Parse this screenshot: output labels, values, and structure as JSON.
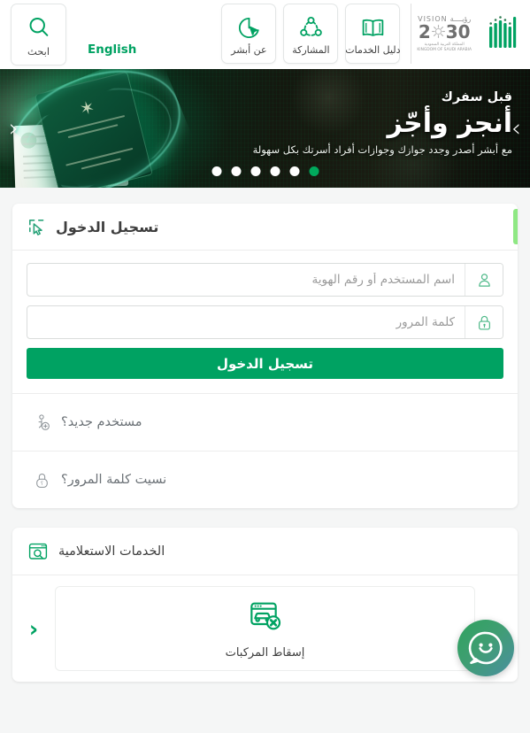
{
  "header": {
    "search_tile": {
      "label": "ابحث",
      "icon": "search-icon"
    },
    "language_link": "English",
    "nav_tiles": [
      {
        "label": "عن أبشر",
        "icon": "cursor-circle-icon"
      },
      {
        "label": "المشاركة",
        "icon": "share-network-icon"
      },
      {
        "label": "دليل الخدمات",
        "icon": "book-icon"
      }
    ],
    "vision_logo": {
      "word": "VISION",
      "arabic_word": "رؤيــــة",
      "year": "2030",
      "kingdom_ar": "المملكة العربية السعودية",
      "kingdom_en": "KINGDOM OF SAUDI ARABIA"
    },
    "absher_logo": "absher-logo"
  },
  "banner": {
    "kicker": "قبل سفرك",
    "title": "أنجز وأجّز",
    "subtitle": "مع أبشر أصدر وجدد جوازك وجوازات أفراد أسرتك بكل سهولة",
    "prev_arrow": "‹",
    "next_arrow": "›",
    "dots_count": 6,
    "active_dot_index": 5
  },
  "login_card": {
    "title": "تسجيل الدخول",
    "title_icon": "select-cursor-icon",
    "accent_color": "#8fe884",
    "username_field": {
      "placeholder": "اسم المستخدم أو رقم الهوية",
      "value": "",
      "icon": "user-icon"
    },
    "password_field": {
      "placeholder": "كلمة المرور",
      "value": "",
      "icon": "lock-icon"
    },
    "submit_label": "تسجيل الدخول",
    "submit_color": "#00a262",
    "links": [
      {
        "label": "مستخدم جديد؟",
        "icon": "user-add-icon"
      },
      {
        "label": "نسيت كلمة المرور؟",
        "icon": "lock-question-icon"
      }
    ]
  },
  "services_card": {
    "title": "الخدمات الاستعلامية",
    "title_icon": "window-search-icon",
    "prev_arrow": "‹",
    "next_arrow": "›",
    "items": [
      {
        "label": "إسقاط المركبات",
        "icon": "vehicle-delete-icon"
      }
    ]
  },
  "chatbot": {
    "icon": "chatbot-avatar-icon"
  }
}
